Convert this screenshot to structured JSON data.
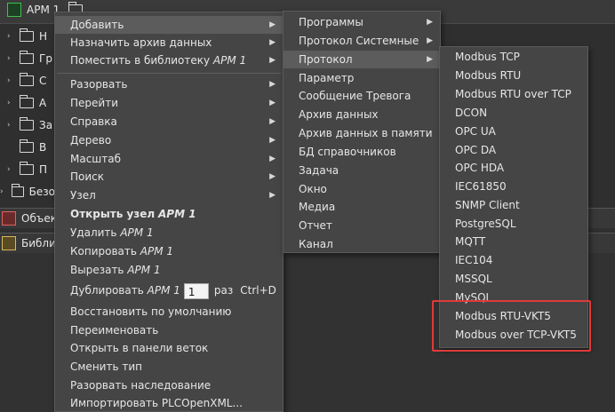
{
  "top": {
    "title": "АРМ 1"
  },
  "tree": [
    {
      "label": "Н",
      "arrow": "›"
    },
    {
      "label": "Гр",
      "arrow": "›"
    },
    {
      "label": "С",
      "arrow": "›"
    },
    {
      "label": "А",
      "arrow": "›"
    },
    {
      "label": "За",
      "arrow": "›"
    },
    {
      "label": "В",
      "arrow": ""
    },
    {
      "label": "П",
      "arrow": "›"
    },
    {
      "label": "Безо",
      "arrow": "›"
    }
  ],
  "panels": {
    "objects": "Объек",
    "library": "Библи"
  },
  "menu1": {
    "items": [
      "Добавить",
      "Назначить архив данных",
      "Поместить в библиотеку",
      "Разорвать",
      "Перейти",
      "Справка",
      "Дерево",
      "Масштаб",
      "Поиск",
      "Узел",
      "Открыть узел",
      "Удалить",
      "Копировать",
      "Вырезать",
      "Дублировать",
      "Восстановить по умолчанию",
      "Переименовать",
      "Открыть в панели веток",
      "Сменить тип",
      "Разорвать наследование",
      "Импортировать PLCOpenXML..."
    ],
    "node_name": "АРМ 1",
    "duplicate_count": "1",
    "times_label": "раз",
    "shortcut": "Ctrl+D"
  },
  "menu2": {
    "items": [
      "Программы",
      "Протокол Системные",
      "Протокол",
      "Параметр",
      "Сообщение Тревога",
      "Архив данных",
      "Архив данных в памяти",
      "БД справочников",
      "Задача",
      "Окно",
      "Медиа",
      "Отчет",
      "Канал"
    ]
  },
  "menu3": {
    "items": [
      "Modbus TCP",
      "Modbus RTU",
      "Modbus RTU over TCP",
      "DCON",
      "OPC UA",
      "OPC DA",
      "OPC HDA",
      "IEC61850",
      "SNMP Client",
      "PostgreSQL",
      "MQTT",
      "IEC104",
      "MSSQL",
      "MySQL",
      "Modbus RTU-VKT5",
      "Modbus over TCP-VKT5"
    ]
  },
  "colors": {
    "menu_bg": "#454545",
    "highlight": "#5c5c5c",
    "annotation": "#e03a3a"
  }
}
